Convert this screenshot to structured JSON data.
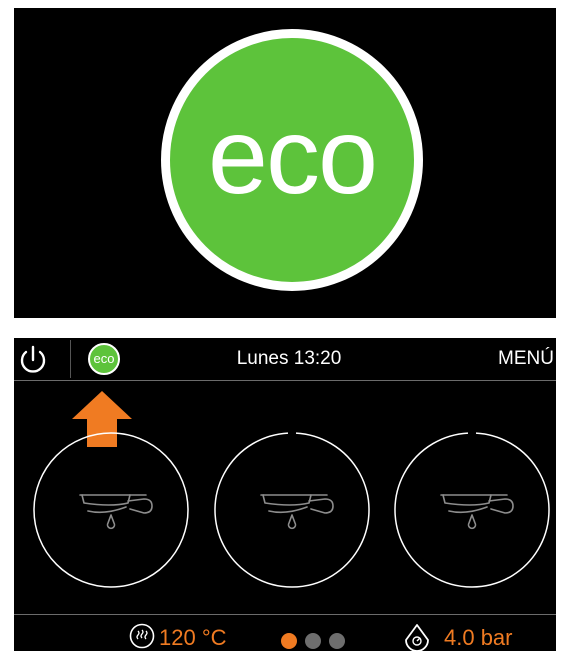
{
  "hero": {
    "badge_text": "eco"
  },
  "topbar": {
    "power_icon": "power-icon",
    "eco_label": "eco",
    "datetime": "Lunes 13:20",
    "menu_label": "MENÚ"
  },
  "groups": [
    {
      "name": "group-1",
      "icon": "portafilter-icon",
      "state": "idle"
    },
    {
      "name": "group-2",
      "icon": "portafilter-icon",
      "state": "idle"
    },
    {
      "name": "group-3",
      "icon": "portafilter-icon",
      "state": "idle"
    }
  ],
  "status": {
    "temperature": "120 °C",
    "pressure": "4.0 bar",
    "page_indicator": {
      "count": 3,
      "active": 0
    }
  },
  "colors": {
    "eco_green": "#5dc33b",
    "accent_orange": "#f07b22",
    "inactive_dot": "#6e6e6e"
  }
}
